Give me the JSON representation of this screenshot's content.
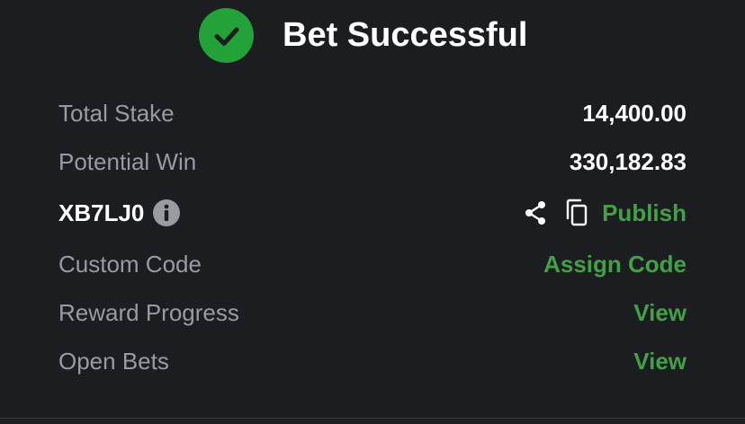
{
  "header": {
    "title": "Bet Successful",
    "status_icon": "check-circle-icon",
    "status_color": "#23a23a"
  },
  "rows": {
    "total_stake": {
      "label": "Total Stake",
      "value": "14,400.00"
    },
    "potential_win": {
      "label": "Potential Win",
      "value": "330,182.83"
    },
    "booking": {
      "code": "XB7LJ0",
      "info_icon": "info-icon",
      "share_icon": "share-icon",
      "copy_icon": "copy-icon",
      "publish_label": "Publish"
    },
    "custom_code": {
      "label": "Custom Code",
      "action": "Assign Code"
    },
    "reward_progress": {
      "label": "Reward Progress",
      "action": "View"
    },
    "open_bets": {
      "label": "Open Bets",
      "action": "View"
    }
  },
  "colors": {
    "background": "#1c1d21",
    "accent_green": "#43a047",
    "muted_text": "#9a9ba1",
    "primary_text": "#ffffff"
  }
}
